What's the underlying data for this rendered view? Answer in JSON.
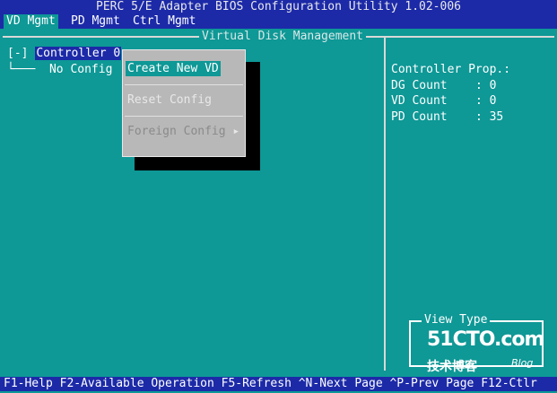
{
  "title": "PERC 5/E Adapter BIOS Configuration Utility 1.02-006",
  "tabs": [
    {
      "label": "VD Mgmt"
    },
    {
      "label": "PD Mgmt"
    },
    {
      "label": "Ctrl Mgmt"
    }
  ],
  "panel_title": "Virtual Disk Management",
  "tree": {
    "root_toggle": "[-]",
    "root_label": "Controller 0",
    "child_label": "No Config"
  },
  "popup_menu": {
    "items": [
      {
        "label": "Create New VD",
        "selected": true
      },
      {
        "label": "Reset Config"
      },
      {
        "label": "Foreign Config",
        "disabled": true,
        "submenu_arrow": "▸"
      }
    ]
  },
  "controller_props": {
    "header": "Controller Prop.:",
    "rows": [
      {
        "label": "DG Count",
        "sep": ":",
        "value": "0"
      },
      {
        "label": "VD Count",
        "sep": ":",
        "value": "0"
      },
      {
        "label": "PD Count",
        "sep": ":",
        "value": "35"
      }
    ]
  },
  "view_type": {
    "title": "View Type"
  },
  "watermark": {
    "main": "51CTO.com",
    "sub": "技术博客",
    "blog": "Blog"
  },
  "status_bar": "F1-Help F2-Available Operation F5-Refresh ^N-Next Page ^P-Prev Page F12-Ctlr",
  "colors": {
    "background": "#0e9896",
    "bar": "#1c2aa8",
    "popup": "#b8b8b8"
  }
}
